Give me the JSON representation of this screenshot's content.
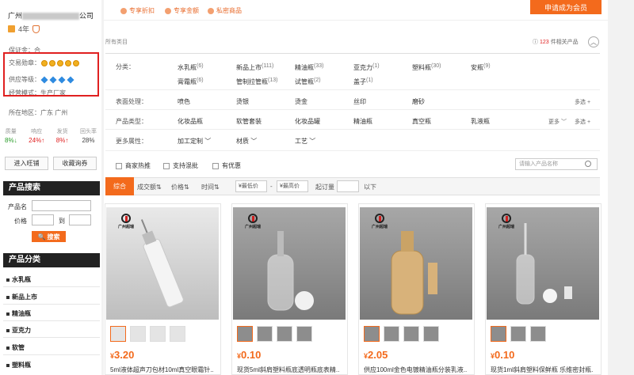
{
  "shop": {
    "name_prefix": "广州",
    "name_suffix": "公司",
    "years": "4年",
    "security_label": "保证金：合",
    "trade_label": "交易勋章：",
    "supply_label": "供应等级：",
    "business_label": "经营模式：生产厂家",
    "location": "所在地区：广东 广州",
    "stats": [
      {
        "label": "质量",
        "value": "8%↓"
      },
      {
        "label": "响应",
        "value": "24%↑"
      },
      {
        "label": "发货",
        "value": "8%↑"
      },
      {
        "label": "回头率",
        "value": "28%"
      }
    ],
    "enter_store": "进入旺铺",
    "favorite": "收藏询券"
  },
  "product_search": {
    "title": "产品搜索",
    "name_label": "产品名",
    "price_label": "价格",
    "to_label": "到",
    "search_button": "搜索"
  },
  "product_category": {
    "title": "产品分类",
    "items": [
      "水乳瓶",
      "新品上市",
      "精油瓶",
      "亚克力",
      "软管",
      "塑料瓶"
    ]
  },
  "topbar": {
    "tags": [
      "专享折扣",
      "专享金额",
      "私密商品"
    ],
    "join_button": "申请成为会员"
  },
  "filters": {
    "all_categories": "所有类目",
    "count_number": "123",
    "count_suffix": "件相关产品",
    "category_label": "分类：",
    "categories": [
      {
        "name": "水乳瓶",
        "count": "(6)"
      },
      {
        "name": "新品上市",
        "count": "(111)"
      },
      {
        "name": "精油瓶",
        "count": "(33)"
      },
      {
        "name": "亚克力",
        "count": "(1)"
      },
      {
        "name": "塑料瓶",
        "count": "(30)"
      },
      {
        "name": "安瓶",
        "count": "(9)"
      },
      {
        "name": "膏霜瓶",
        "count": "(6)"
      },
      {
        "name": "管制拉管瓶",
        "count": "(13)"
      },
      {
        "name": "试管瓶",
        "count": "(2)"
      },
      {
        "name": "盖子",
        "count": "(1)"
      }
    ],
    "surface_label": "表面处理：",
    "surface": [
      "喷色",
      "烫银",
      "烫金",
      "丝印",
      "磨砂"
    ],
    "multi_select": "多选",
    "type_label": "产品类型：",
    "types": [
      "化妆品瓶",
      "软管套装",
      "化妆品罐",
      "精油瓶",
      "真空瓶",
      "乳液瓶"
    ],
    "more": "更多",
    "attr_label": "更多属性：",
    "attrs": [
      "加工定制",
      "材质",
      "工艺"
    ]
  },
  "options": {
    "checks": [
      "商家热推",
      "支持混批",
      "有优惠"
    ],
    "search_placeholder": "请输入产品名称"
  },
  "sortbar": {
    "active": "综合",
    "items": [
      "成交额",
      "价格",
      "时间"
    ],
    "price_min": "¥最低价",
    "dash": "-",
    "price_max": "¥最高价",
    "moq_label": "起订量",
    "below": "以下"
  },
  "products": [
    {
      "price": "3.20",
      "title": "5ml液体超声刀包材10ml真空眼霜针..."
    },
    {
      "price": "0.10",
      "title": "现货5ml斜肩塑料瓶底透明瓶底表精..."
    },
    {
      "price": "2.05",
      "title": "供应100ml金色电镀精油瓶分装乳液..."
    },
    {
      "price": "0.10",
      "title": "现货1ml斜肩塑料保鲜瓶 乐维密封瓶..."
    }
  ],
  "brand_logo_text": "广州超瑞",
  "colors": {
    "accent": "#f36a1c",
    "highlight_box": "#e02020",
    "sidebar_header": "#222222"
  }
}
